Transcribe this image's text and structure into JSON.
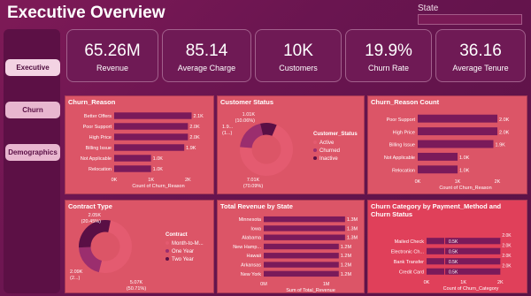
{
  "header": {
    "title": "Executive Overview",
    "state_label": "State"
  },
  "sidebar": {
    "items": [
      {
        "label": "Executive"
      },
      {
        "label": "Churn"
      },
      {
        "label": "Demographics"
      }
    ]
  },
  "kpis": [
    {
      "value": "65.26M",
      "label": "Revenue"
    },
    {
      "value": "85.14",
      "label": "Average Charge"
    },
    {
      "value": "10K",
      "label": "Customers"
    },
    {
      "value": "19.9%",
      "label": "Churn Rate"
    },
    {
      "value": "36.16",
      "label": "Average Tenure"
    }
  ],
  "colors": {
    "background": "#6a1550",
    "panel": "#dc5567",
    "bar": "#7a1a5a",
    "donut_dark": "#5a0f45",
    "donut_mid": "#9b2e6e",
    "donut_light": "#e45b70"
  },
  "chart_data": [
    {
      "type": "bar",
      "title": "Churn_Reason",
      "orientation": "horizontal",
      "categories": [
        "Better Offers",
        "Poor Support",
        "High Price",
        "Billing Issue",
        "Not Applicable",
        "Relocation"
      ],
      "values": [
        2.1,
        2.0,
        2.0,
        1.9,
        1.0,
        1.0
      ],
      "value_labels": [
        "2.1K",
        "2.0K",
        "2.0K",
        "1.9K",
        "1.0K",
        "1.0K"
      ],
      "xticks": [
        "0K",
        "1K",
        "2K"
      ],
      "xlabel": "Count of Churn_Reason",
      "xlim": [
        0,
        2.4
      ]
    },
    {
      "type": "pie",
      "title": "Customer Status",
      "legend_title": "Customer_Status",
      "legend": [
        "Active",
        "Churned",
        "Inactive"
      ],
      "values": [
        7.01,
        1.99,
        1.01
      ],
      "labels": [
        "7.01K\n(70.09%)",
        "1.9...\n(1...)",
        "1.01K\n(10.06%)"
      ]
    },
    {
      "type": "bar",
      "title": "Churn_Reason Count",
      "orientation": "horizontal",
      "categories": [
        "Poor Support",
        "High Price",
        "Billing Issue",
        "Not Applicable",
        "Relocation"
      ],
      "values": [
        2.0,
        2.0,
        1.9,
        1.0,
        1.0
      ],
      "value_labels": [
        "2.0K",
        "2.0K",
        "1.9K",
        "1.0K",
        "1.0K"
      ],
      "xticks": [
        "0K",
        "1K",
        "2K"
      ],
      "xlabel": "Count of Churn_Reason",
      "xlim": [
        0,
        2.4
      ]
    },
    {
      "type": "pie",
      "title": "Contract Type",
      "legend_title": "Contract",
      "legend": [
        "Month-to-M...",
        "One Year",
        "Two Year"
      ],
      "values": [
        5.07,
        2.05,
        2.88
      ],
      "labels": [
        "5.07K\n(50.71%)",
        "2.05K\n(20.45%)",
        "2.09K\n(2...)"
      ]
    },
    {
      "type": "bar",
      "title": "Total Revenue by State",
      "orientation": "horizontal",
      "categories": [
        "Minnesota",
        "Iowa",
        "Alabama",
        "New Hamp...",
        "Hawaii",
        "Arkansas",
        "New York"
      ],
      "values": [
        1.3,
        1.3,
        1.3,
        1.2,
        1.2,
        1.2,
        1.2
      ],
      "value_labels": [
        "1.3M",
        "1.3M",
        "1.3M",
        "1.2M",
        "1.2M",
        "1.2M",
        "1.2M"
      ],
      "xticks": [
        "0M",
        "1M"
      ],
      "xlabel": "Sum of Total_Revenue",
      "xlim": [
        0,
        1.5
      ]
    },
    {
      "type": "bar",
      "title": "Churn Category by Payment_Method and Churn Status",
      "orientation": "horizontal",
      "categories": [
        "Mailed Check",
        "Electronic Ch...",
        "Bank Transfer",
        "Credit Card"
      ],
      "values": [
        2.0,
        2.0,
        2.0,
        2.0
      ],
      "value_labels": [
        "0.5K",
        "0.5K",
        "0.5K",
        "0.5K"
      ],
      "right_labels": [
        "2.0K",
        "2.0K",
        "2.0K",
        "2.0K"
      ],
      "xticks": [
        "0K",
        "1K",
        "2K"
      ],
      "xlabel": "Count of Churn_Category",
      "xlim": [
        0,
        2.4
      ]
    }
  ]
}
